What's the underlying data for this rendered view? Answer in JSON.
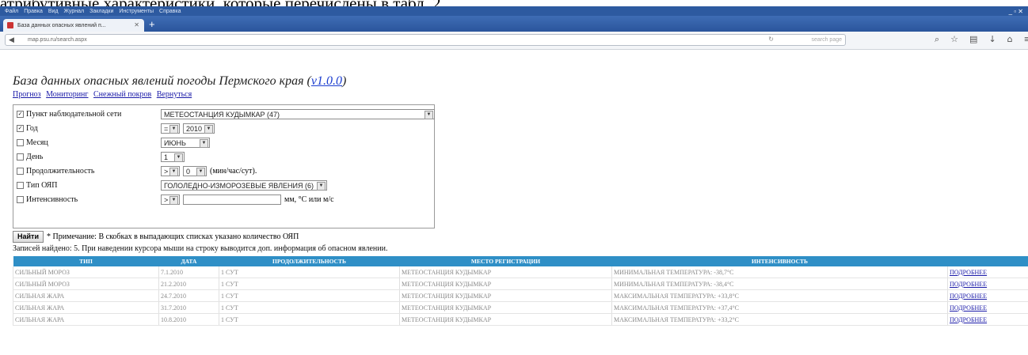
{
  "doc_text": "атрибутивные характеристики, которые перечислены в табл. 2.",
  "browser": {
    "menu": [
      "Файл",
      "Правка",
      "Вид",
      "Журнал",
      "Закладки",
      "Инструменты",
      "Справка"
    ],
    "tab_title": "База данных опасных явлений п...",
    "new_tab": "+",
    "url": "map.psu.ru/search.aspx",
    "search_placeholder": "search page",
    "window_controls": "_ ▫ ✕"
  },
  "page": {
    "title": "База данных опасных явлений погоды Пермского края (",
    "version": "v1.0.0",
    "title_close": ")",
    "links": [
      "Прогноз",
      "Мониторинг",
      "Снежный покров",
      "Вернуться"
    ],
    "filters": {
      "station": {
        "label": "Пункт наблюдательной сети",
        "checked": true,
        "value": "МЕТЕОСТАНЦИЯ КУДЫМКАР (47)"
      },
      "year": {
        "label": "Год",
        "checked": true,
        "op": "=",
        "value": "2010"
      },
      "month": {
        "label": "Месяц",
        "checked": false,
        "value": "ИЮНЬ"
      },
      "day": {
        "label": "День",
        "checked": false,
        "value": "1"
      },
      "duration": {
        "label": "Продолжительность",
        "checked": false,
        "op": ">",
        "value": "0",
        "unit": "(мин/час/сут)."
      },
      "type": {
        "label": "Тип ОЯП",
        "checked": false,
        "value": "ГОЛОЛЕДНО-ИЗМОРОЗЕВЫЕ ЯВЛЕНИЯ (6)"
      },
      "intensity": {
        "label": "Интенсивность",
        "checked": false,
        "op": ">",
        "unit": "мм, °С или м/с"
      }
    },
    "find_button": "Найти",
    "note": "* Примечание: В скобках в выпадающих списках указано количество ОЯП",
    "records": "Записей найдено: 5. При наведении курсора мыши на строку выводится доп. информация об опасном явлении.",
    "table": {
      "headers": [
        "ТИП",
        "ДАТА",
        "ПРОДОЛЖИТЕЛЬНОСТЬ",
        "МЕСТО РЕГИСТРАЦИИ",
        "ИНТЕНСИВНОСТЬ",
        ""
      ],
      "rows": [
        [
          "СИЛЬНЫЙ МОРОЗ",
          "7.1.2010",
          "1 СУТ",
          "МЕТЕОСТАНЦИЯ КУДЫМКАР",
          "МИНИМАЛЬНАЯ ТЕМПЕРАТУРА: -38,7°С",
          "ПОДРОБНЕЕ"
        ],
        [
          "СИЛЬНЫЙ МОРОЗ",
          "21.2.2010",
          "1 СУТ",
          "МЕТЕОСТАНЦИЯ КУДЫМКАР",
          "МИНИМАЛЬНАЯ ТЕМПЕРАТУРА: -38,4°С",
          "ПОДРОБНЕЕ"
        ],
        [
          "СИЛЬНАЯ ЖАРА",
          "24.7.2010",
          "1 СУТ",
          "МЕТЕОСТАНЦИЯ КУДЫМКАР",
          "МАКСИМАЛЬНАЯ ТЕМПЕРАТУРА: +33,8°С",
          "ПОДРОБНЕЕ"
        ],
        [
          "СИЛЬНАЯ ЖАРА",
          "31.7.2010",
          "1 СУТ",
          "МЕТЕОСТАНЦИЯ КУДЫМКАР",
          "МАКСИМАЛЬНАЯ ТЕМПЕРАТУРА: +37,4°С",
          "ПОДРОБНЕЕ"
        ],
        [
          "СИЛЬНАЯ ЖАРА",
          "10.8.2010",
          "1 СУТ",
          "МЕТЕОСТАНЦИЯ КУДЫМКАР",
          "МАКСИМАЛЬНАЯ ТЕМПЕРАТУРА: +33,2°С",
          "ПОДРОБНЕЕ"
        ]
      ]
    }
  }
}
